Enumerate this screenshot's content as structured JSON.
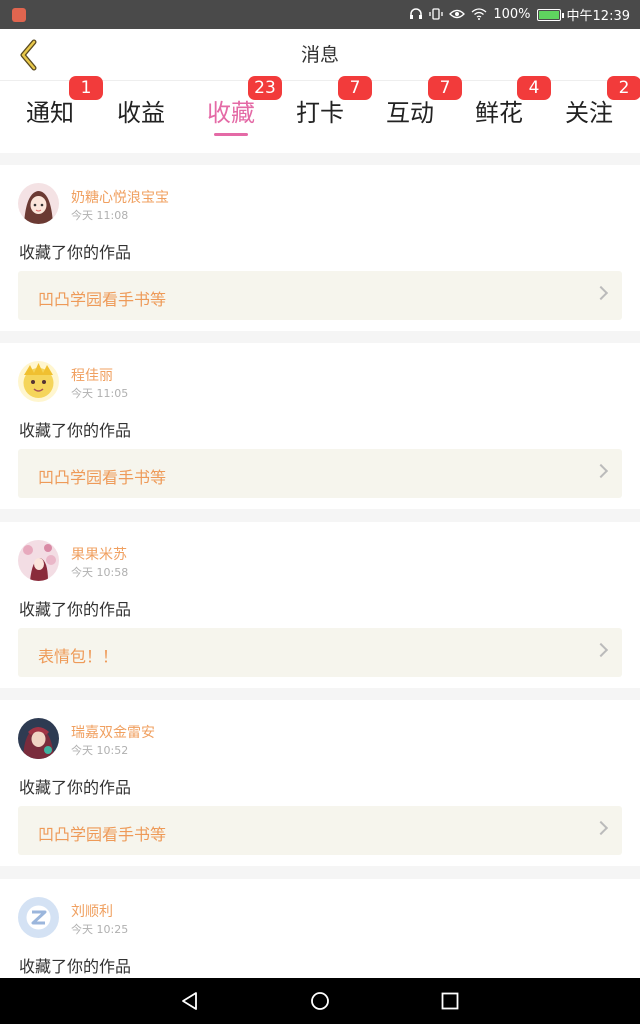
{
  "status_bar": {
    "battery": "100%",
    "time": "中午12:39",
    "battery_level": 1.0
  },
  "header": {
    "title": "消息"
  },
  "tabs": [
    {
      "label": "通知",
      "badge": "1"
    },
    {
      "label": "收益",
      "badge": ""
    },
    {
      "label": "收藏",
      "badge": "23",
      "active": true
    },
    {
      "label": "打卡",
      "badge": "7"
    },
    {
      "label": "互动",
      "badge": "7"
    },
    {
      "label": "鲜花",
      "badge": "4"
    },
    {
      "label": "关注",
      "badge": "2"
    }
  ],
  "items": [
    {
      "user": "奶糖心悦浪宝宝",
      "time": "今天 11:08",
      "action": "收藏了你的作品",
      "work": "凹凸学园看手书等",
      "avatar_icon": "girl-avatar-icon"
    },
    {
      "user": "程佳丽",
      "time": "今天 11:05",
      "action": "收藏了你的作品",
      "work": "凹凸学园看手书等",
      "avatar_icon": "yellow-character-avatar-icon"
    },
    {
      "user": "果果米苏",
      "time": "今天 10:58",
      "action": "收藏了你的作品",
      "work": "表情包！！",
      "avatar_icon": "blossom-avatar-icon"
    },
    {
      "user": "瑞嘉双金雷安",
      "time": "今天 10:52",
      "action": "收藏了你的作品",
      "work": "凹凸学园看手书等",
      "avatar_icon": "dark-character-avatar-icon"
    },
    {
      "user": "刘顺利",
      "time": "今天 10:25",
      "action": "收藏了你的作品",
      "work": "",
      "avatar_icon": "default-avatar-icon"
    }
  ],
  "colors": {
    "accent": "#e46aa6",
    "badge": "#f23b3b",
    "username": "#f0a060",
    "work_title": "#ee9a58"
  }
}
